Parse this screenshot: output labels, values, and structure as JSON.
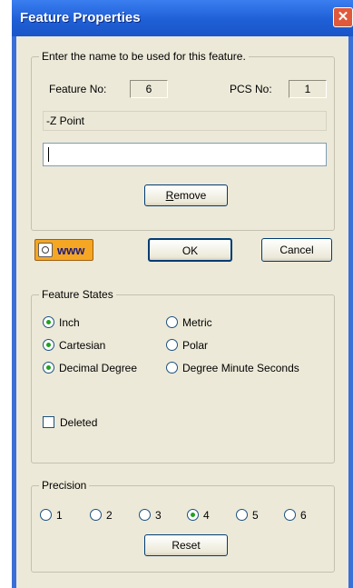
{
  "window": {
    "title": "Feature Properties",
    "close_glyph": "✕"
  },
  "name_group": {
    "legend": "Enter the name to be used for this feature.",
    "feature_no_label": "Feature No:",
    "feature_no_value": "6",
    "pcs_no_label": "PCS No:",
    "pcs_no_value": "1",
    "feature_name": "-Z Point",
    "name_input_value": "",
    "remove_prefix": "",
    "remove_accel": "R",
    "remove_rest": "emove"
  },
  "actions": {
    "www_label": "www",
    "www_icon": "globe-icon",
    "ok_label": "OK",
    "cancel_label": "Cancel"
  },
  "feature_states": {
    "legend": "Feature States",
    "unit_options": [
      {
        "label": "Inch",
        "selected": true
      },
      {
        "label": "Metric",
        "selected": false
      }
    ],
    "coord_options": [
      {
        "label": "Cartesian",
        "selected": true
      },
      {
        "label": "Polar",
        "selected": false
      }
    ],
    "angle_options": [
      {
        "label": "Decimal Degree",
        "selected": true
      },
      {
        "label": "Degree Minute Seconds",
        "selected": false
      }
    ],
    "deleted_label": "Deleted",
    "deleted_checked": false
  },
  "precision": {
    "legend": "Precision",
    "options": [
      "1",
      "2",
      "3",
      "4",
      "5",
      "6"
    ],
    "selected": "4",
    "reset_label": "Reset"
  },
  "colors": {
    "title_bar": "#2060d8",
    "dialog_bg": "#ece9d8",
    "www_button": "#f5a623"
  }
}
